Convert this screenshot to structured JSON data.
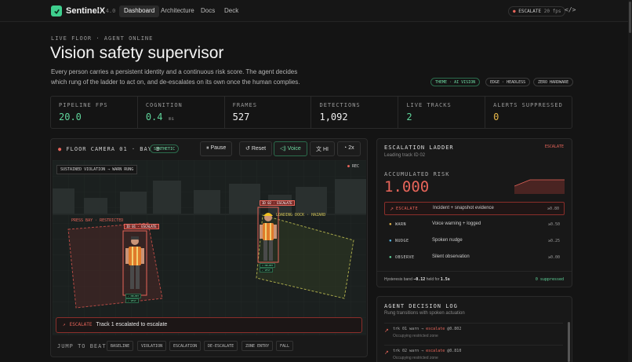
{
  "nav": {
    "brand": "SentinelX",
    "version": "v1.4.0",
    "links": [
      "Dashboard",
      "Architecture",
      "Docs",
      "Deck"
    ],
    "status_pill": "ESCALATE",
    "fps": "20 fps",
    "code_icon": "</>"
  },
  "hero": {
    "eyebrow": "LIVE FLOOR · AGENT ONLINE",
    "title": "Vision safety supervisor",
    "description": "Every person carries a persistent identity and a continuous risk score. The agent decides which rung of the ladder to act on, and de-escalates on its own once the human complies.",
    "tags": [
      "THEME · AI VISION",
      "EDGE · HEADLESS",
      "ZERO HARDWARE"
    ]
  },
  "stats": [
    {
      "label": "PIPELINE FPS",
      "value": "20.0",
      "unit": "",
      "color": "green"
    },
    {
      "label": "COGNITION",
      "value": "0.4",
      "unit": "ms",
      "color": "green"
    },
    {
      "label": "FRAMES",
      "value": "527",
      "unit": "",
      "color": "white"
    },
    {
      "label": "DETECTIONS",
      "value": "1,092",
      "unit": "",
      "color": "white"
    },
    {
      "label": "LIVE TRACKS",
      "value": "2",
      "unit": "",
      "color": "green"
    },
    {
      "label": "ALERTS SUPPRESSED",
      "value": "0",
      "unit": "",
      "color": "yellow"
    }
  ],
  "camera": {
    "title": "FLOOR CAMERA 01 · BAY B",
    "badge": "SYNTHETIC",
    "buttons": {
      "pause": "Pause",
      "reset": "Reset",
      "voice": "Voice",
      "lang": "HI",
      "speed": "2x"
    },
    "overlay_banner": "SUSTAINED VIOLATION → WARN RUNG",
    "rec": "REC",
    "zones": {
      "press_bay": "PRESS BAY · RESTRICTED",
      "loading_dock": "LOADING DOCK · HAZARD"
    },
    "tracks": [
      {
        "id": "ID 01 · ESCALATE",
        "chips": [
          "✓ HELMET",
          "✓ VEST"
        ]
      },
      {
        "id": "ID 02 · ESCALATE",
        "chips": [
          "✕ HELMET",
          "✓ VEST"
        ]
      }
    ],
    "alert": {
      "level": "ESCALATE",
      "text": "Track 1 escalated to escalate"
    },
    "jump_label": "JUMP TO BEAT",
    "beats": [
      "BASELINE",
      "VIOLATION",
      "ESCALATION",
      "DE-ESCALATE",
      "ZONE ENTRY",
      "FALL"
    ]
  },
  "ladder": {
    "title": "ESCALATION LADDER",
    "subtitle": "Leading track ID 02",
    "state": "ESCALATE",
    "risk_label": "ACCUMULATED RISK",
    "risk_value": "1.000",
    "rungs": [
      {
        "name": "ESCALATE",
        "desc": "Incident + snapshot evidence",
        "threshold": "≥0.80",
        "color": "#e8655a",
        "active": true
      },
      {
        "name": "WARN",
        "desc": "Voice warning + logged",
        "threshold": "≥0.50",
        "color": "#e8b84a",
        "active": false
      },
      {
        "name": "NUDGE",
        "desc": "Spoken nudge",
        "threshold": "≥0.25",
        "color": "#5ab8e8",
        "active": false
      },
      {
        "name": "OBSERVE",
        "desc": "Silent observation",
        "threshold": "≥0.00",
        "color": "#5fd49a",
        "active": false
      }
    ],
    "hysteresis_prefix": "Hysteresis band",
    "hysteresis_value": "−0.12",
    "hysteresis_mid": "held for",
    "hysteresis_time": "1.5s",
    "suppressed": "0 suppressed"
  },
  "log": {
    "title": "AGENT DECISION LOG",
    "subtitle": "Rung transitions with spoken actuation",
    "entries": [
      {
        "trk": "trk 01",
        "from": "warn",
        "to": "escalate",
        "risk": "@0.802",
        "note": "Occupying restricted zone"
      },
      {
        "trk": "trk 02",
        "from": "warn",
        "to": "escalate",
        "risk": "@0.810",
        "note": "Occupying restricted zone"
      }
    ]
  }
}
